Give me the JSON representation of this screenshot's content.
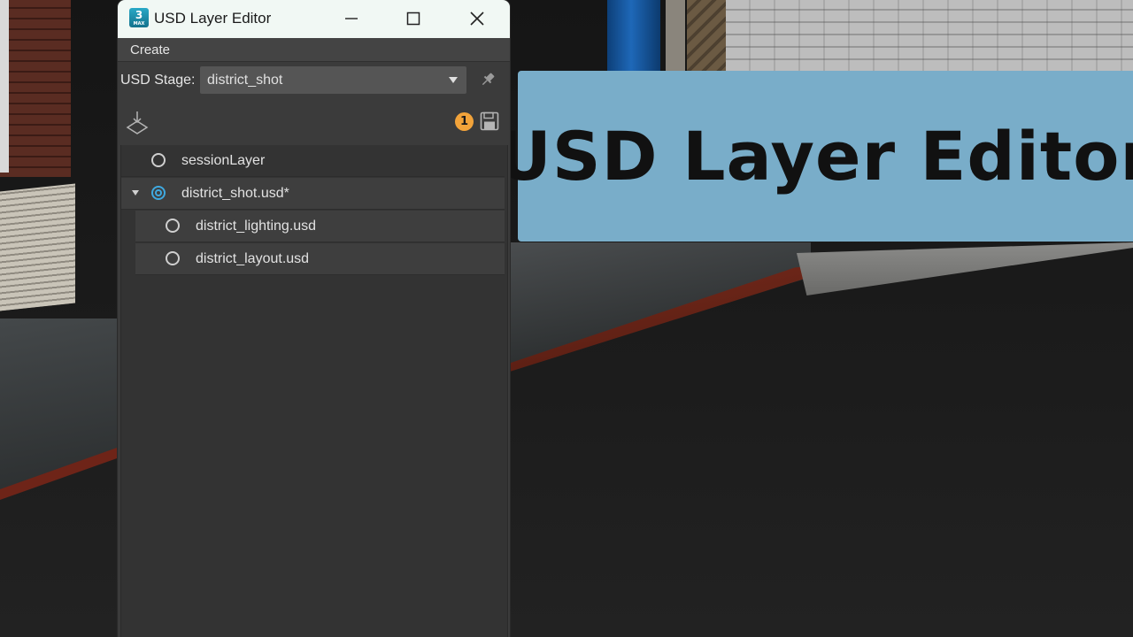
{
  "overlay_title": "USD Layer Editor",
  "window": {
    "title": "USD Layer Editor",
    "app_icon_text": "3",
    "app_icon_subtext": "MAX"
  },
  "menu": {
    "create": "Create"
  },
  "stage": {
    "label": "USD Stage:",
    "selected": "district_shot"
  },
  "toolbar": {
    "unsaved_count": "1"
  },
  "layers": [
    {
      "name": "sessionLayer",
      "depth": 0,
      "active": false,
      "expanded": null,
      "highlight": false
    },
    {
      "name": "district_shot.usd*",
      "depth": 0,
      "active": true,
      "expanded": true,
      "highlight": true
    },
    {
      "name": "district_lighting.usd",
      "depth": 1,
      "active": false,
      "expanded": null,
      "highlight": true
    },
    {
      "name": "district_layout.usd",
      "depth": 1,
      "active": false,
      "expanded": null,
      "highlight": true
    }
  ],
  "colors": {
    "title_card": "#79adc9",
    "active_radio": "#3fa9e0",
    "badge": "#f2a33a"
  }
}
